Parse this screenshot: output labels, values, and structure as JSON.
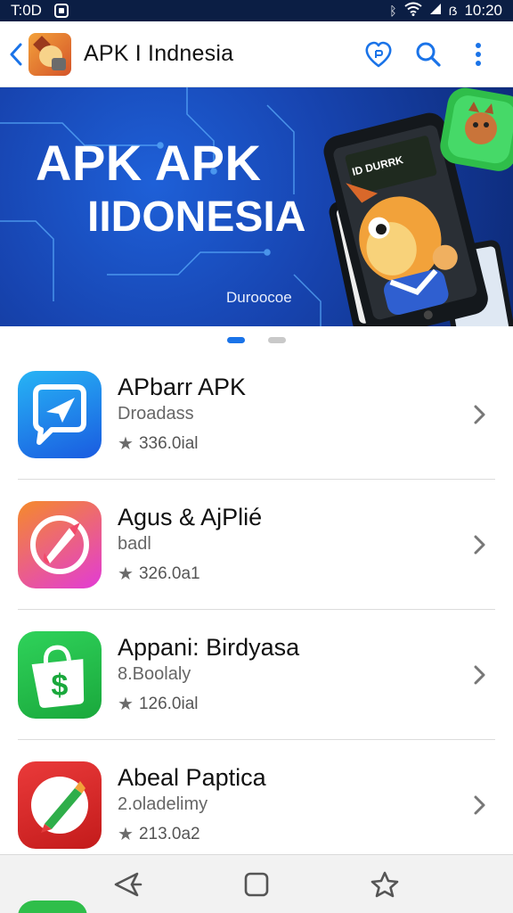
{
  "status_bar": {
    "time": "T:0D",
    "indicators": "ᛒ",
    "battery_text": "ẞ",
    "clock_right": "10:20"
  },
  "app_bar": {
    "title": "APK I Indnesia",
    "icons": [
      "back-chevron-icon",
      "app-logo",
      "heart-icon",
      "search-icon",
      "more-vert-icon"
    ]
  },
  "banner": {
    "title_line_1": "APK APK",
    "title_line_2": "IIDONESIA",
    "caption": "Duroocoe",
    "phone_screen_text": "ID DURRK",
    "accent_colors": [
      "#1744b0",
      "#2fbe4a",
      "#f08a1c"
    ]
  },
  "carousel": {
    "page_count": 2,
    "active_index": 0
  },
  "apps": [
    {
      "name": "APbarr APK",
      "subtitle": "Droadass",
      "rating_text": "336.0ial",
      "icon": "paper-plane-chat-icon",
      "icon_colors": [
        "#27b4f5",
        "#1a5be0"
      ]
    },
    {
      "name": "Agus & AjPlié",
      "subtitle": "badl",
      "rating_text": "326.0a1",
      "icon": "rocket-icon",
      "icon_colors": [
        "#f58a2a",
        "#e23bd6"
      ]
    },
    {
      "name": "Appani: Birdyasa",
      "subtitle": "8.Boolaly",
      "rating_text": "126.0ial",
      "icon": "shopping-bag-dollar-icon",
      "icon_colors": [
        "#2fd25a",
        "#1aa83c"
      ]
    },
    {
      "name": "Abeal Paptica",
      "subtitle": "2.oladelimy",
      "rating_text": "213.0a2",
      "icon": "pen-icon",
      "icon_colors": [
        "#ea3a3a",
        "#c31b1b"
      ]
    }
  ],
  "bottom_nav": {
    "items": [
      "back-icon",
      "home-square-icon",
      "star-icon"
    ]
  }
}
